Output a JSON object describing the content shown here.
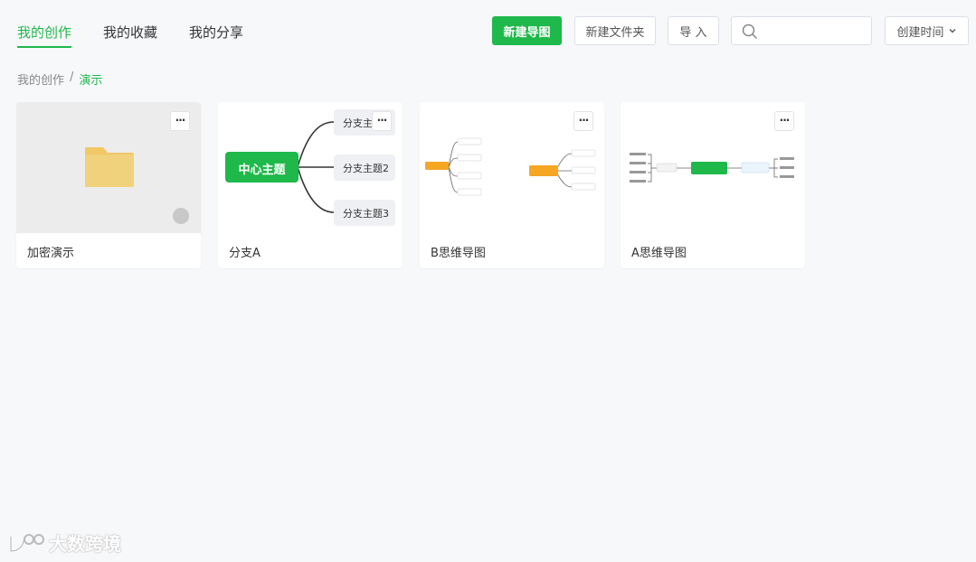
{
  "tabs": [
    {
      "label": "我的创作",
      "active": true
    },
    {
      "label": "我的收藏",
      "active": false
    },
    {
      "label": "我的分享",
      "active": false
    }
  ],
  "toolbar": {
    "new_map": "新建导图",
    "new_folder": "新建文件夹",
    "import": "导 入",
    "search_placeholder": "",
    "sort_label": "创建时间"
  },
  "breadcrumb": {
    "root": "我的创作",
    "sep": "/",
    "current": "演示"
  },
  "cards": [
    {
      "title": "加密演示",
      "type": "folder"
    },
    {
      "title": "分支A",
      "type": "map",
      "center": "中心主题",
      "branches": [
        "分支主",
        "分支主题2",
        "分支主题3"
      ]
    },
    {
      "title": "B思维导图",
      "type": "map"
    },
    {
      "title": "A思维导图",
      "type": "map"
    }
  ],
  "more_label": "···",
  "watermark": "大数跨境",
  "colors": {
    "accent": "#1fb84a",
    "folder": "#f2c866",
    "orange": "#f5a623"
  }
}
